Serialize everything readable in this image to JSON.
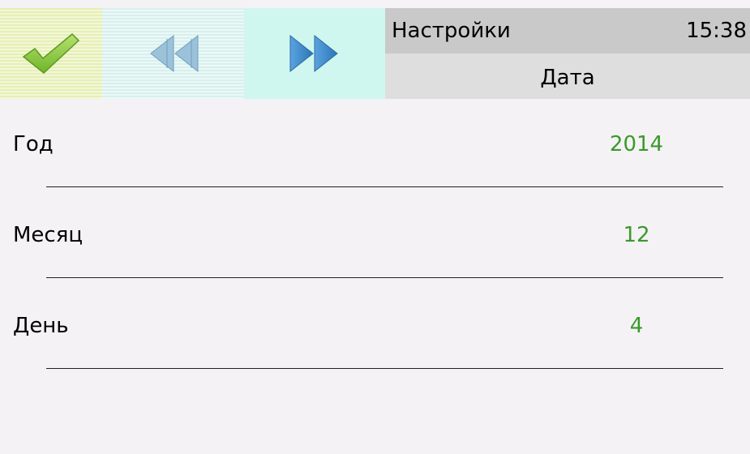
{
  "toolbar": {
    "ok_icon": "checkmark-icon",
    "prev_icon": "rewind-icon",
    "next_icon": "fast-forward-icon"
  },
  "header": {
    "title": "Настройки",
    "clock": "15:38",
    "subtitle": "Дата"
  },
  "rows": [
    {
      "label": "Год",
      "value": "2014"
    },
    {
      "label": "Месяц",
      "value": "12"
    },
    {
      "label": "День",
      "value": "4"
    }
  ],
  "colors": {
    "value_text": "#3a9a2a",
    "check_green": "#8fcf3a",
    "arrow_prev": "#8ab6d0",
    "arrow_next": "#3a88c8"
  }
}
